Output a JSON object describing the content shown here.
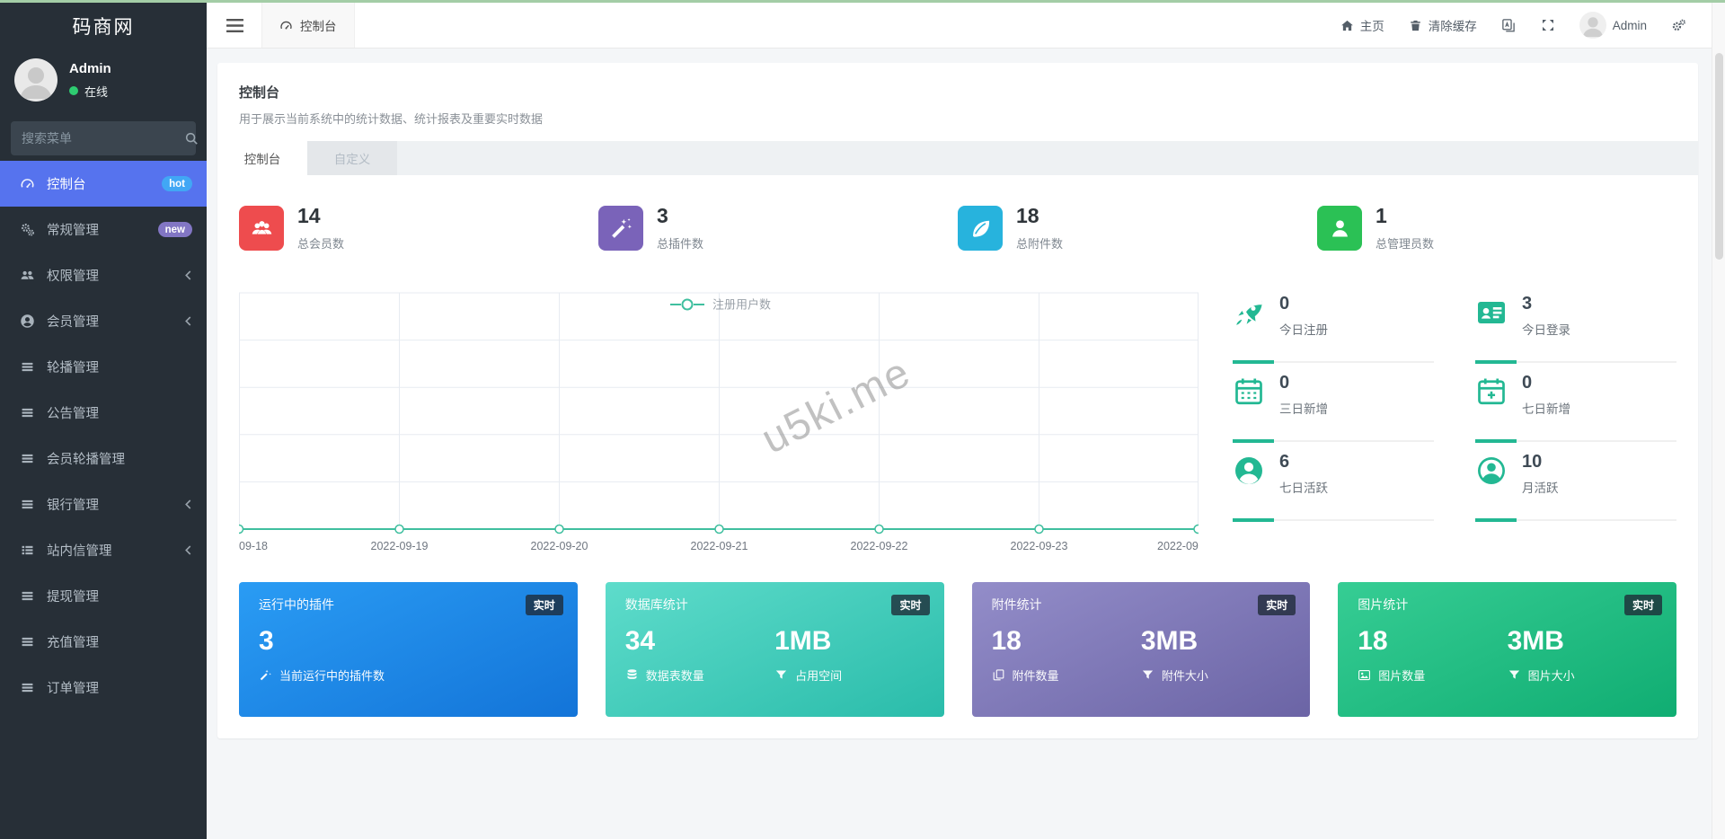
{
  "app": {
    "logo": "码商网"
  },
  "sidebar": {
    "user_name": "Admin",
    "user_status": "在线",
    "search_placeholder": "搜索菜单",
    "items": [
      {
        "label": "控制台",
        "badge": "hot"
      },
      {
        "label": "常规管理",
        "badge": "new"
      },
      {
        "label": "权限管理"
      },
      {
        "label": "会员管理"
      },
      {
        "label": "轮播管理"
      },
      {
        "label": "公告管理"
      },
      {
        "label": "会员轮播管理"
      },
      {
        "label": "银行管理"
      },
      {
        "label": "站内信管理"
      },
      {
        "label": "提现管理"
      },
      {
        "label": "充值管理"
      },
      {
        "label": "订单管理"
      }
    ]
  },
  "topbar": {
    "tab_label": "控制台",
    "home_label": "主页",
    "clear_cache_label": "清除缓存",
    "user_name": "Admin"
  },
  "page": {
    "title": "控制台",
    "subtitle": "用于展示当前系统中的统计数据、统计报表及重要实时数据",
    "tabs": [
      {
        "label": "控制台"
      },
      {
        "label": "自定义"
      }
    ]
  },
  "stats": [
    {
      "value": "14",
      "label": "总会员数",
      "icon": "group-icon",
      "color": "#ee4c4e"
    },
    {
      "value": "3",
      "label": "总插件数",
      "icon": "magic-wand-icon",
      "color": "#7a63b9"
    },
    {
      "value": "18",
      "label": "总附件数",
      "icon": "leaf-icon",
      "color": "#27b3dd"
    },
    {
      "value": "1",
      "label": "总管理员数",
      "icon": "person-icon",
      "color": "#2bc155"
    }
  ],
  "chart_data": {
    "type": "line",
    "series": [
      {
        "name": "注册用户数",
        "values": [
          0,
          0,
          0,
          0,
          0,
          0,
          0
        ]
      }
    ],
    "x": [
      "09-18",
      "2022-09-19",
      "2022-09-20",
      "2022-09-21",
      "2022-09-22",
      "2022-09-23",
      "2022-09"
    ],
    "ylim": [
      0,
      4
    ],
    "grid": true,
    "legend_position": "top-center",
    "line_color": "#3fbf9f",
    "watermark": "u5ki.me"
  },
  "mini_stats": [
    {
      "value": "0",
      "label": "今日注册",
      "icon": "rocket-icon"
    },
    {
      "value": "3",
      "label": "今日登录",
      "icon": "id-card-icon"
    },
    {
      "value": "0",
      "label": "三日新增",
      "icon": "calendar-icon"
    },
    {
      "value": "0",
      "label": "七日新增",
      "icon": "calendar-plus-icon"
    },
    {
      "value": "6",
      "label": "七日活跃",
      "icon": "user-circle-filled-icon"
    },
    {
      "value": "10",
      "label": "月活跃",
      "icon": "user-circle-outline-icon"
    }
  ],
  "cards": [
    {
      "title": "运行中的插件",
      "badge": "实时",
      "metrics": [
        {
          "value": "3",
          "label": "当前运行中的插件数",
          "icon": "magic-wand-icon"
        }
      ]
    },
    {
      "title": "数据库统计",
      "badge": "实时",
      "metrics": [
        {
          "value": "34",
          "label": "数据表数量",
          "icon": "database-icon"
        },
        {
          "value": "1MB",
          "label": "占用空间",
          "icon": "filter-icon"
        }
      ]
    },
    {
      "title": "附件统计",
      "badge": "实时",
      "metrics": [
        {
          "value": "18",
          "label": "附件数量",
          "icon": "copy-icon"
        },
        {
          "value": "3MB",
          "label": "附件大小",
          "icon": "filter-icon"
        }
      ]
    },
    {
      "title": "图片统计",
      "badge": "实时",
      "metrics": [
        {
          "value": "18",
          "label": "图片数量",
          "icon": "image-icon"
        },
        {
          "value": "3MB",
          "label": "图片大小",
          "icon": "filter-icon"
        }
      ]
    }
  ],
  "colors": {
    "top_accent": "#a3cda6",
    "sidebar_bg": "#272f37",
    "sidebar_active": "#5673ee",
    "badge_hot": "#41a7f5",
    "badge_new": "#8276c4",
    "online_dot": "#2ecc71",
    "mini_icon_green": "#23b893",
    "chart_line": "#3fbf9f",
    "card_blue": "#1e88e5",
    "card_teal": "#3cc8b4",
    "card_purple": "#7e77b5",
    "card_green": "#21c287"
  }
}
